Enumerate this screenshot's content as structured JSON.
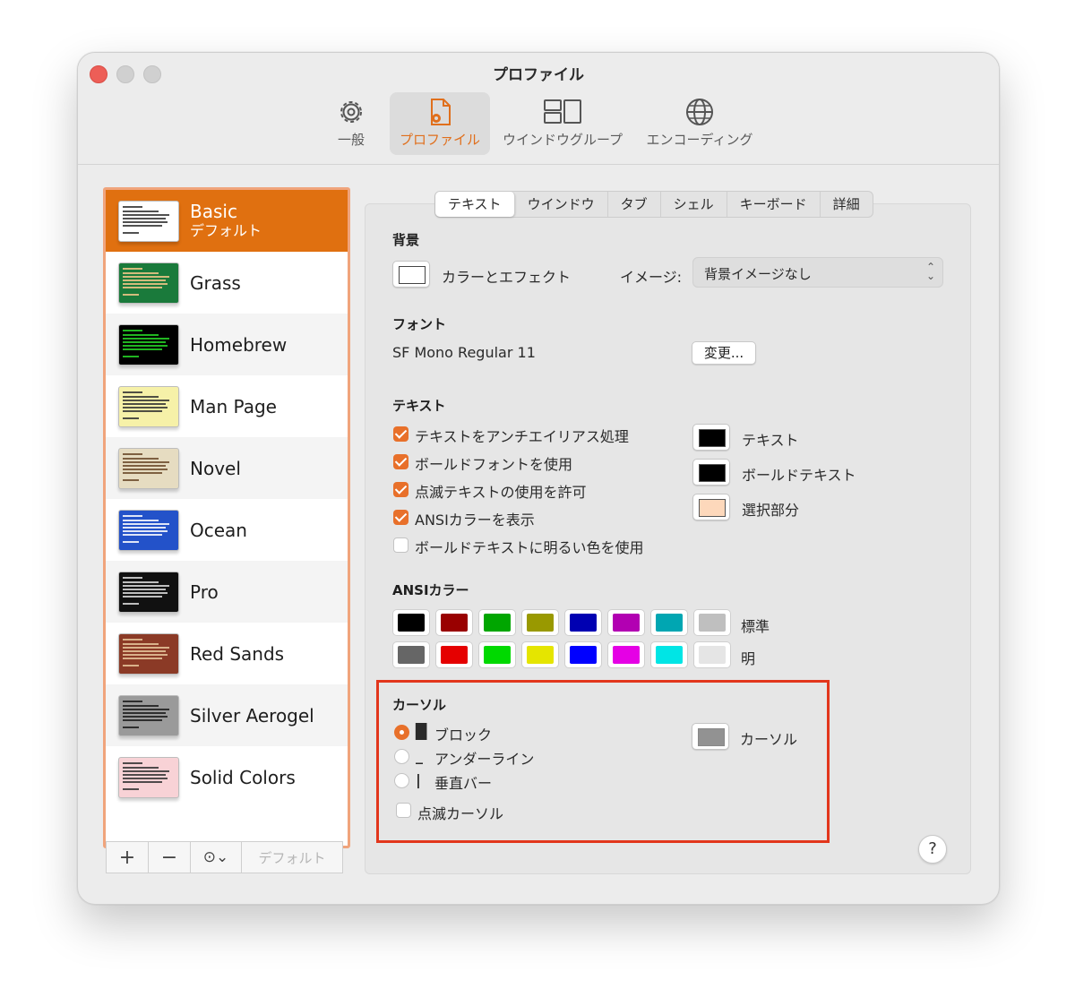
{
  "window": {
    "title": "プロファイル"
  },
  "toolbar": {
    "general": "一般",
    "profiles": "プロファイル",
    "window_groups": "ウインドウグループ",
    "encodings": "エンコーディング",
    "active_color": "#e06f1c"
  },
  "profiles": [
    {
      "name": "Basic",
      "subtitle": "デフォルト",
      "selected": true,
      "thumb_bg": "#ffffff",
      "thumb_line": "#333333"
    },
    {
      "name": "Grass",
      "thumb_bg": "#1a7a3b",
      "thumb_line": "#f4c88a"
    },
    {
      "name": "Homebrew",
      "thumb_bg": "#000000",
      "thumb_line": "#27d527"
    },
    {
      "name": "Man Page",
      "thumb_bg": "#f6f1a8",
      "thumb_line": "#333333"
    },
    {
      "name": "Novel",
      "thumb_bg": "#e6dcc1",
      "thumb_line": "#6b4a2a"
    },
    {
      "name": "Ocean",
      "thumb_bg": "#2352c9",
      "thumb_line": "#ffffff"
    },
    {
      "name": "Pro",
      "thumb_bg": "#111111",
      "thumb_line": "#dddddd"
    },
    {
      "name": "Red Sands",
      "thumb_bg": "#8b3a26",
      "thumb_line": "#e6c79c"
    },
    {
      "name": "Silver Aerogel",
      "thumb_bg": "#9a9a9a",
      "thumb_line": "#1b1b1b"
    },
    {
      "name": "Solid Colors",
      "thumb_bg": "#f8d2d6",
      "thumb_line": "#333333"
    }
  ],
  "sidebar_buttons": {
    "add": "+",
    "remove": "−",
    "more": "⊙⌄",
    "default": "デフォルト"
  },
  "tabs": [
    "テキスト",
    "ウインドウ",
    "タブ",
    "シェル",
    "キーボード",
    "詳細"
  ],
  "active_tab": "テキスト",
  "background": {
    "section": "背景",
    "color_effects": "カラーとエフェクト",
    "image_label": "イメージ:",
    "image_value": "背景イメージなし"
  },
  "font": {
    "section": "フォント",
    "value": "SF Mono Regular 11",
    "change_button": "変更..."
  },
  "text": {
    "section": "テキスト",
    "options": [
      {
        "label": "テキストをアンチエイリアス処理",
        "checked": true
      },
      {
        "label": "ボールドフォントを使用",
        "checked": true
      },
      {
        "label": "点滅テキストの使用を許可",
        "checked": true
      },
      {
        "label": "ANSIカラーを表示",
        "checked": true
      },
      {
        "label": "ボールドテキストに明るい色を使用",
        "checked": false
      }
    ],
    "colors": [
      {
        "label": "テキスト",
        "color": "#000000"
      },
      {
        "label": "ボールドテキスト",
        "color": "#000000"
      },
      {
        "label": "選択部分",
        "color": "#fdd8bb"
      }
    ]
  },
  "ansi": {
    "section": "ANSIカラー",
    "normal_label": "標準",
    "bright_label": "明",
    "normal": [
      "#000000",
      "#990000",
      "#00a600",
      "#999900",
      "#0000b2",
      "#b200b2",
      "#00a6b2",
      "#bfbfbf"
    ],
    "bright": [
      "#666666",
      "#e50000",
      "#00d900",
      "#e5e500",
      "#0000ff",
      "#e500e5",
      "#00e5e5",
      "#e5e5e5"
    ]
  },
  "cursor": {
    "section": "カーソル",
    "options": [
      {
        "glyph": "█",
        "label": "ブロック",
        "selected": true
      },
      {
        "glyph": "_",
        "label": "アンダーライン",
        "selected": false
      },
      {
        "glyph": "|",
        "label": "垂直バー",
        "selected": false
      }
    ],
    "blink_label": "点滅カーソル",
    "blink_checked": false,
    "color_label": "カーソル",
    "color": "#929292"
  },
  "help": "?"
}
